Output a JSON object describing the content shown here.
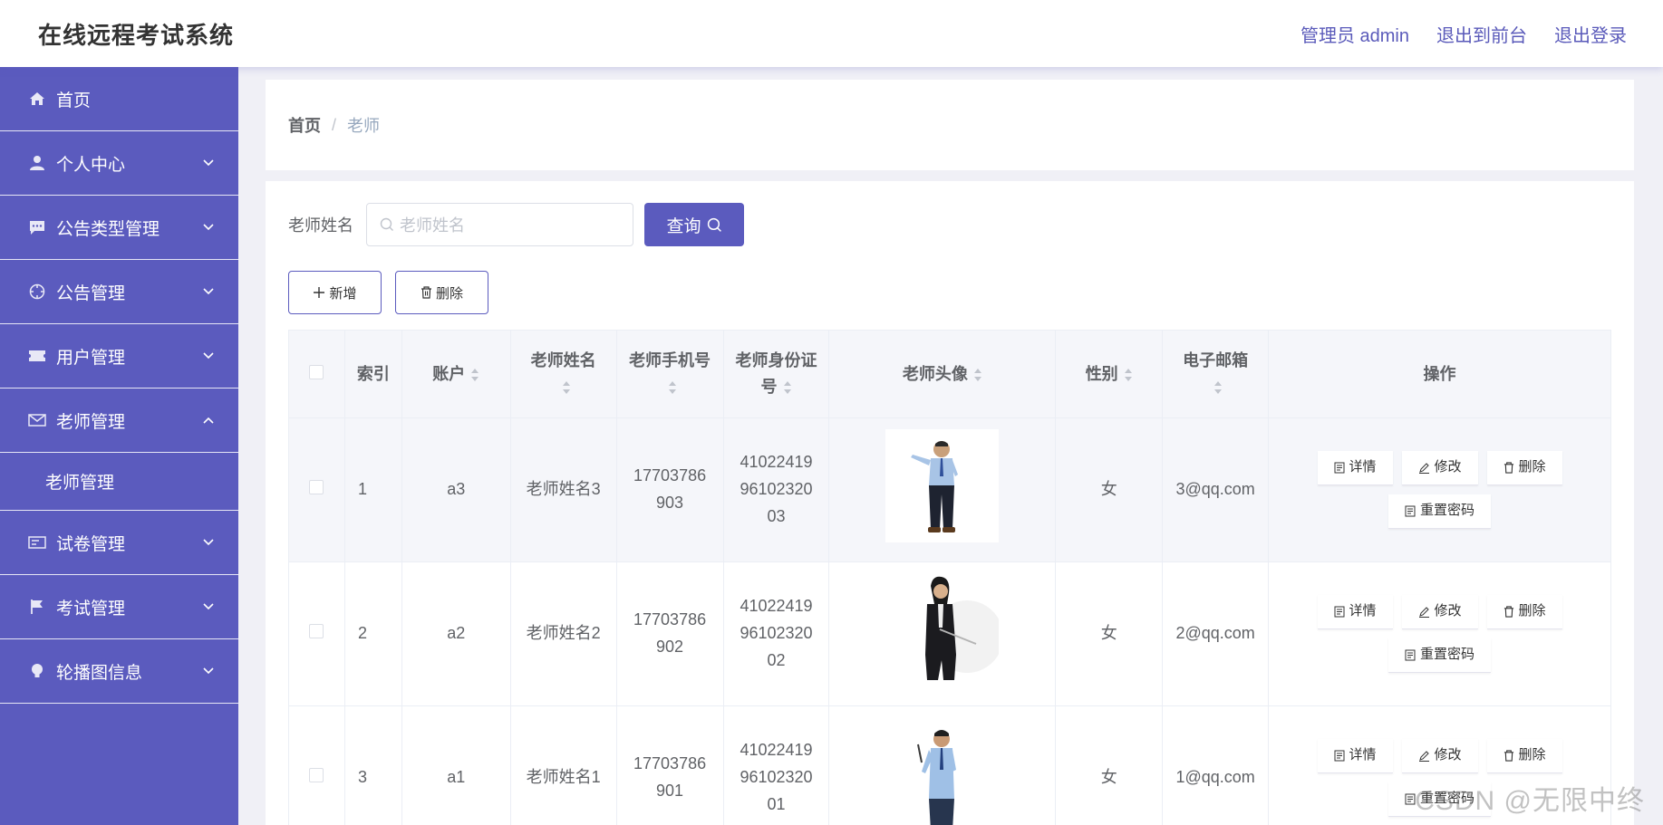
{
  "header": {
    "title": "在线远程考试系统",
    "admin_link": "管理员 admin",
    "front_link": "退出到前台",
    "logout_link": "退出登录"
  },
  "sidebar": {
    "items": [
      {
        "label": "首页",
        "icon": "home-icon"
      },
      {
        "label": "个人中心",
        "icon": "user-icon"
      },
      {
        "label": "公告类型管理",
        "icon": "chat-icon"
      },
      {
        "label": "公告管理",
        "icon": "compass-icon"
      },
      {
        "label": "用户管理",
        "icon": "ticket-icon"
      },
      {
        "label": "老师管理",
        "icon": "mail-icon",
        "expanded": true,
        "children": [
          {
            "label": "老师管理"
          }
        ]
      },
      {
        "label": "试卷管理",
        "icon": "card-icon"
      },
      {
        "label": "考试管理",
        "icon": "flag-icon"
      },
      {
        "label": "轮播图信息",
        "icon": "bulb-icon"
      }
    ],
    "bg_color": "#5b5bbe"
  },
  "breadcrumb": {
    "home": "首页",
    "separator": "/",
    "current": "老师"
  },
  "search": {
    "label": "老师姓名",
    "placeholder": "老师姓名",
    "query_button": "查询"
  },
  "actions": {
    "add": "新增",
    "delete": "删除"
  },
  "table": {
    "headers": {
      "index": "索引",
      "account": "账户",
      "name": "老师姓名",
      "phone": "老师手机号",
      "idcard_line1": "老师身份证",
      "idcard_line2": "号",
      "avatar": "老师头像",
      "gender": "性别",
      "email": "电子邮箱",
      "ops": "操作"
    },
    "rows": [
      {
        "index": "1",
        "account": "a3",
        "name": "老师姓名3",
        "phone1": "17703786",
        "phone2": "903",
        "id1": "41022419",
        "id2": "96102320",
        "id3": "03",
        "gender": "女",
        "email": "3@qq.com"
      },
      {
        "index": "2",
        "account": "a2",
        "name": "老师姓名2",
        "phone1": "17703786",
        "phone2": "902",
        "id1": "41022419",
        "id2": "96102320",
        "id3": "02",
        "gender": "女",
        "email": "2@qq.com"
      },
      {
        "index": "3",
        "account": "a1",
        "name": "老师姓名1",
        "phone1": "17703786",
        "phone2": "901",
        "id1": "41022419",
        "id2": "96102320",
        "id3": "01",
        "gender": "女",
        "email": "1@qq.com"
      }
    ],
    "op_labels": {
      "detail": "详情",
      "edit": "修改",
      "delete": "删除",
      "reset": "重置密码"
    }
  },
  "watermark": "CSDN @无限中终",
  "accent_color": "#5b5bbe"
}
